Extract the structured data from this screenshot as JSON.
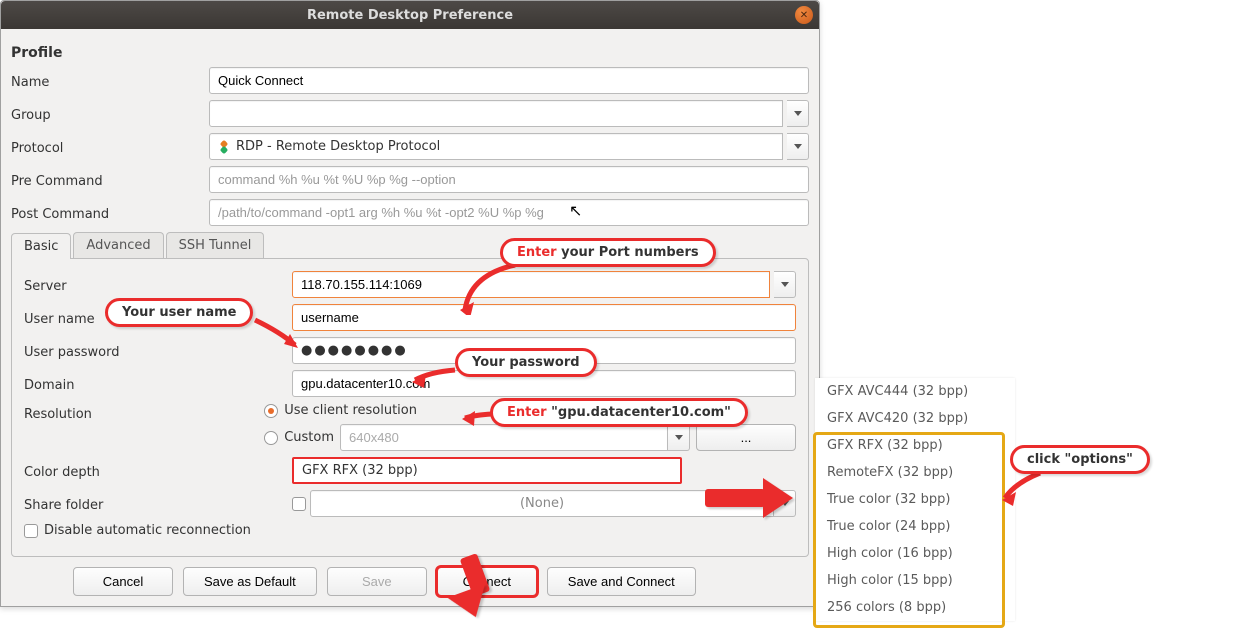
{
  "window": {
    "title": "Remote Desktop Preference"
  },
  "profile": {
    "heading": "Profile",
    "name_label": "Name",
    "name_value": "Quick Connect",
    "group_label": "Group",
    "group_value": "",
    "protocol_label": "Protocol",
    "protocol_value": "RDP - Remote Desktop Protocol",
    "precmd_label": "Pre Command",
    "precmd_placeholder": "command %h %u %t %U %p %g --option",
    "postcmd_label": "Post Command",
    "postcmd_placeholder": "/path/to/command -opt1 arg %h %u %t -opt2 %U %p %g"
  },
  "tabs": {
    "basic": "Basic",
    "advanced": "Advanced",
    "ssh": "SSH Tunnel"
  },
  "basic": {
    "server_label": "Server",
    "server_value": "118.70.155.114:1069",
    "user_label": "User name",
    "user_value": "username",
    "password_label": "User password",
    "password_value": "●●●●●●●●",
    "domain_label": "Domain",
    "domain_value": "gpu.datacenter10.com",
    "resolution_label": "Resolution",
    "resolution_client": "Use client resolution",
    "resolution_custom": "Custom",
    "resolution_custom_value": "640x480",
    "more_btn": "...",
    "colordepth_label": "Color depth",
    "colordepth_value": "GFX RFX (32 bpp)",
    "sharefolder_label": "Share folder",
    "sharefolder_value": "(None)",
    "disable_reconnect": "Disable automatic reconnection"
  },
  "buttons": {
    "cancel": "Cancel",
    "save_default": "Save as Default",
    "save": "Save",
    "connect": "Connect",
    "save_connect": "Save and Connect"
  },
  "callouts": {
    "port": "your Port numbers",
    "port_em": "Enter ",
    "username": "Your user name",
    "password": "Your password",
    "domain_em": "Enter ",
    "domain_rest": "\"gpu.datacenter10.com\"",
    "options": "click \"options\""
  },
  "dropdown": {
    "options": [
      "GFX AVC444 (32 bpp)",
      "GFX AVC420 (32 bpp)",
      "GFX RFX (32 bpp)",
      "RemoteFX (32 bpp)",
      "True color (32 bpp)",
      "True color (24 bpp)",
      "High color (16 bpp)",
      "High color (15 bpp)",
      "256 colors (8 bpp)"
    ]
  }
}
